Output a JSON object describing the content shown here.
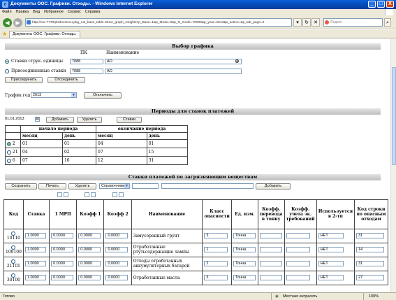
{
  "window": {
    "title": "Документы ООС. Графики. Отходы. - Windows Internet Explorer",
    "controls": [
      "_",
      "□",
      "X"
    ]
  },
  "menu": [
    "Файл",
    "Правка",
    "Вид",
    "Избранное",
    "Сервис",
    "Справка"
  ],
  "address": {
    "url": "http://ora-7778/plsdocs/ecu.pkg_rus_base_table.Show_graph_weights?p_Base=1&p_Mode=0&p_N_mode=70008&p_year=2013&p_action=&p_tab_page=2",
    "search_placeholder": "Яндекс"
  },
  "tab": {
    "label": "Документы ООС. Графики. Отходы."
  },
  "graph_select": {
    "header": "Выбор графика",
    "col_pk": "ПК",
    "col_name": "Наименование",
    "options": [
      {
        "label": "Ставки струк. единицы",
        "pk": "7088",
        "name": "АО",
        "selected": true
      },
      {
        "label": "Присоединенные ставки",
        "pk": "7088",
        "name": "АО",
        "selected": false
      }
    ],
    "btn_attach": "Присоединить",
    "btn_detach": "Отсоединить",
    "year_label": "График год",
    "year_value": "2013",
    "btn_refresh": "Отключить"
  },
  "periods": {
    "header": "Периоды для ставок платежей",
    "date_value": "01.01.2013",
    "btn_add": "Добавить",
    "btn_delete": "Удалить",
    "btn_rates": "Ставки",
    "col_start": "начало периода",
    "col_end": "окончание периода",
    "sub_month": "месяц",
    "sub_day": "день",
    "rows": [
      {
        "id": "2",
        "selected": true,
        "start_month": "01",
        "start_day": "01",
        "end_month": "04",
        "end_day": "01"
      },
      {
        "id": "21",
        "selected": false,
        "start_month": "04",
        "start_day": "02",
        "end_month": "07",
        "end_day": "15"
      },
      {
        "id": "6",
        "selected": false,
        "start_month": "07",
        "start_day": "16",
        "end_month": "12",
        "end_day": "31"
      }
    ]
  },
  "rates": {
    "header": "Ставки платежей по загрязняющим веществам",
    "btn_save": "Сохранить",
    "btn_print": "Печать",
    "btn_delete": "Удалить",
    "dropdown": "Справочники",
    "btn_add": "Добавить",
    "columns": [
      "Код",
      "Ставка",
      "1 МРП",
      "Коэфф 1",
      "Коэфф 2",
      "Наименование",
      "Класс опасности",
      "Ед. изм.",
      "Коэфф. перевода в тонну",
      "Коэфф. учета эк. требований",
      "Используется в 2-тп",
      "Код строки по опасным отходам"
    ],
    "rows": [
      {
        "code": "10110",
        "rate": "1.0000",
        "mrp": "0.0000",
        "k1": "0.0000",
        "k2": "0.0000",
        "name": "Замусоренный грунт",
        "class": "3",
        "unit": "Тонна",
        "conv": "",
        "eco": "",
        "used": "НЕТ",
        "line": "31"
      },
      {
        "code": "109100",
        "rate": "1.0000",
        "mrp": "0.0000",
        "k1": "0.0000",
        "k2": "0.0000",
        "name": "Отработанные ртутьсодержащие лампы",
        "class": "1",
        "unit": "Тонна",
        "conv": "",
        "eco": "",
        "used": "НЕТ",
        "line": "14"
      },
      {
        "code": "21101",
        "rate": "1.0000",
        "mrp": "0.0000",
        "k1": "0.0000",
        "k2": "0.0000",
        "name": "Отходы отработанных аккумуляторных батарей",
        "class": "2",
        "unit": "Тонна",
        "conv": "",
        "eco": "",
        "used": "НЕТ",
        "line": "31"
      },
      {
        "code": "30100",
        "rate": "1.0000",
        "mrp": "0.0000",
        "k1": "0.0000",
        "k2": "0.0000",
        "name": "Отработанные масла",
        "class": "3",
        "unit": "Тонна",
        "conv": "",
        "eco": "",
        "used": "НЕТ",
        "line": "27"
      }
    ]
  },
  "status": {
    "left": "Готово",
    "zone": "Местная интрасеть",
    "zoom": "100%"
  },
  "colors": {
    "titlebar": "#0648b6",
    "section": "#bdbdbd",
    "radio_dot": "#1d9d1d"
  }
}
